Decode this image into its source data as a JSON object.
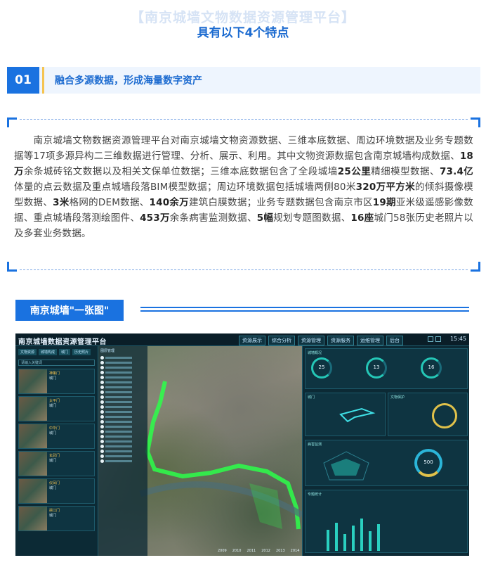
{
  "header": {
    "title": "【南京城墙文物数据资源管理平台】",
    "subtitle": "具有以下4个特点"
  },
  "section": {
    "number": "01",
    "title": "融合多源数据，形成海量数字资产"
  },
  "paragraph": {
    "p1": "南京城墙文物数据资源管理平台对南京城墙文物资源数据、三维本底数据、周边环境数据及业务专题数据等17项多源异构二三维数据进行管理、分析、展示、利用。其中文物资源数据包含南京城墙构成数据、",
    "b1": "18万",
    "p2": "余条城砖铭文数据以及相关文保单位数据；三维本底数据包含了全段城墙",
    "b2": "25公里",
    "p3": "精细模型数据、",
    "b3": "73.4亿",
    "p4": "体量的点云数据及重点城墙段落BIM模型数据；周边环境数据包括城墙两侧80米",
    "b4": "320万平方米",
    "p5": "的倾斜摄像模型数据、",
    "b5": "3米",
    "p6": "格网的DEM数据、",
    "b6": "140余万",
    "p7": "建筑白膜数据；业务专题数据包含南京市区",
    "b7": "19期",
    "p8": "亚米级遥感影像数据、重点城墙段落测绘图件、",
    "b8": "453万",
    "p9": "余条病害监测数据、",
    "b9": "5幅",
    "p10": "规划专题图数据、",
    "b10": "16座",
    "p11": "城门58张历史老照片以及多套业务数据。"
  },
  "map_section": {
    "tag": "南京城墙\"一张图\""
  },
  "dashboard": {
    "title": "南京城墙数据资源管理平台",
    "nav": [
      "资源展示",
      "综合分析",
      "资源管理",
      "资源服务",
      "运维管理",
      "后台"
    ],
    "clock": "15:45",
    "tabs": [
      "文物资源",
      "城墙构成",
      "城门",
      "历史照片"
    ],
    "search_placeholder": "请输入关键词",
    "cards": [
      {
        "name": "神策门",
        "desc": "城门"
      },
      {
        "name": "太平门",
        "desc": "城门"
      },
      {
        "name": "中华门",
        "desc": "城门"
      },
      {
        "name": "玄武门",
        "desc": "城门"
      },
      {
        "name": "仪凤门",
        "desc": "城门"
      },
      {
        "name": "挹江门",
        "desc": "城门"
      }
    ],
    "layers_title": "图层管理",
    "years": [
      "2009",
      "2010",
      "2011",
      "2012",
      "2013",
      "2014"
    ],
    "right_panels": [
      "城墙概况",
      "城门",
      "文物保护",
      "病害监测",
      "专题统计"
    ],
    "ring_values": [
      "25",
      "13",
      "16"
    ],
    "big_ring_value": "500"
  },
  "colors": {
    "accent": "#1a72e0",
    "highlight": "#f5c451",
    "dashboard_bg": "#0b2530",
    "wall_line": "#2cff4a"
  }
}
